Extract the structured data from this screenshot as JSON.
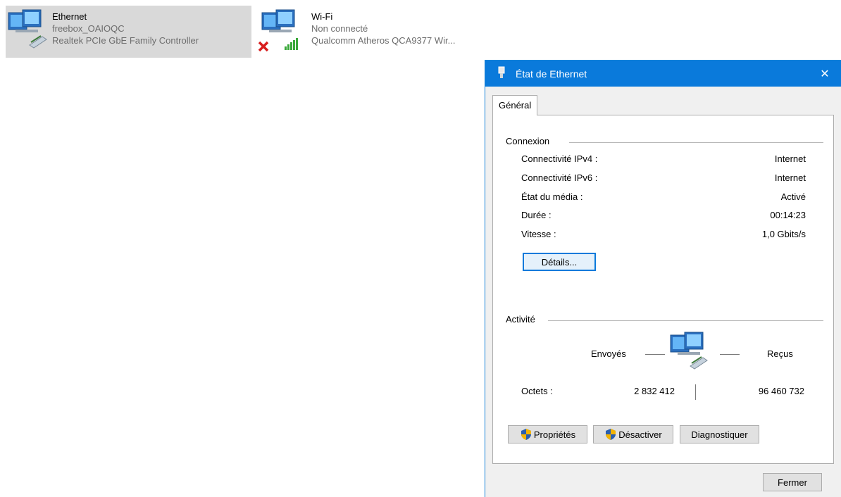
{
  "adapters": {
    "ethernet": {
      "icon": "network-adapter-icon",
      "name": "Ethernet",
      "network": "freebox_OAIOQC",
      "device": "Realtek PCIe GbE Family Controller"
    },
    "wifi": {
      "icon": "wifi-adapter-icon",
      "name": "Wi-Fi",
      "status": "Non connecté",
      "device": "Qualcomm Atheros QCA9377 Wir..."
    }
  },
  "dialog": {
    "title": "État de Ethernet",
    "close_glyph": "✕",
    "tab": "Général",
    "connexion": {
      "label": "Connexion",
      "rows": [
        {
          "label": "Connectivité IPv4 :",
          "value": "Internet"
        },
        {
          "label": "Connectivité IPv6 :",
          "value": "Internet"
        },
        {
          "label": "État du média :",
          "value": "Activé"
        },
        {
          "label": "Durée :",
          "value": "00:14:23"
        },
        {
          "label": "Vitesse :",
          "value": "1,0 Gbits/s"
        }
      ],
      "details_button": "Détails..."
    },
    "activite": {
      "label": "Activité",
      "sent_label": "Envoyés",
      "received_label": "Reçus",
      "bytes_label": "Octets :",
      "bytes_sent": "2 832 412",
      "bytes_received": "96 460 732"
    },
    "buttons": {
      "properties": "Propriétés",
      "disable": "Désactiver",
      "diagnose": "Diagnostiquer",
      "close": "Fermer"
    }
  },
  "colors": {
    "titlebar": "#0a7adb",
    "selection": "#d9d9d9",
    "accent_border": "#0a7adb"
  }
}
